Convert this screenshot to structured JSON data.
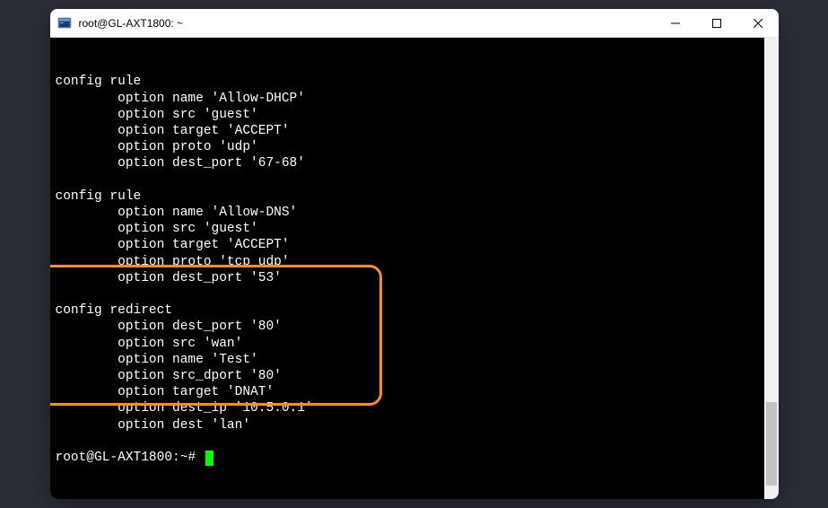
{
  "titlebar": {
    "title": "root@GL-AXT1800: ~"
  },
  "terminal": {
    "blocks": [
      {
        "header": "config rule",
        "options": [
          "option name 'Allow-DHCP'",
          "option src 'guest'",
          "option target 'ACCEPT'",
          "option proto 'udp'",
          "option dest_port '67-68'"
        ]
      },
      {
        "header": "config rule",
        "options": [
          "option name 'Allow-DNS'",
          "option src 'guest'",
          "option target 'ACCEPT'",
          "option proto 'tcp udp'",
          "option dest_port '53'"
        ]
      },
      {
        "header": "config redirect",
        "options": [
          "option dest_port '80'",
          "option src 'wan'",
          "option name 'Test'",
          "option src_dport '80'",
          "option target 'DNAT'",
          "option dest_ip '10.5.0.1'",
          "option dest 'lan'"
        ]
      }
    ],
    "prompt": "root@GL-AXT1800:~# "
  },
  "highlight": {
    "block_index": 2,
    "color": "#ff8c1a"
  },
  "scrollbar": {
    "thumb_top_pct": 79,
    "thumb_height_pct": 18
  }
}
